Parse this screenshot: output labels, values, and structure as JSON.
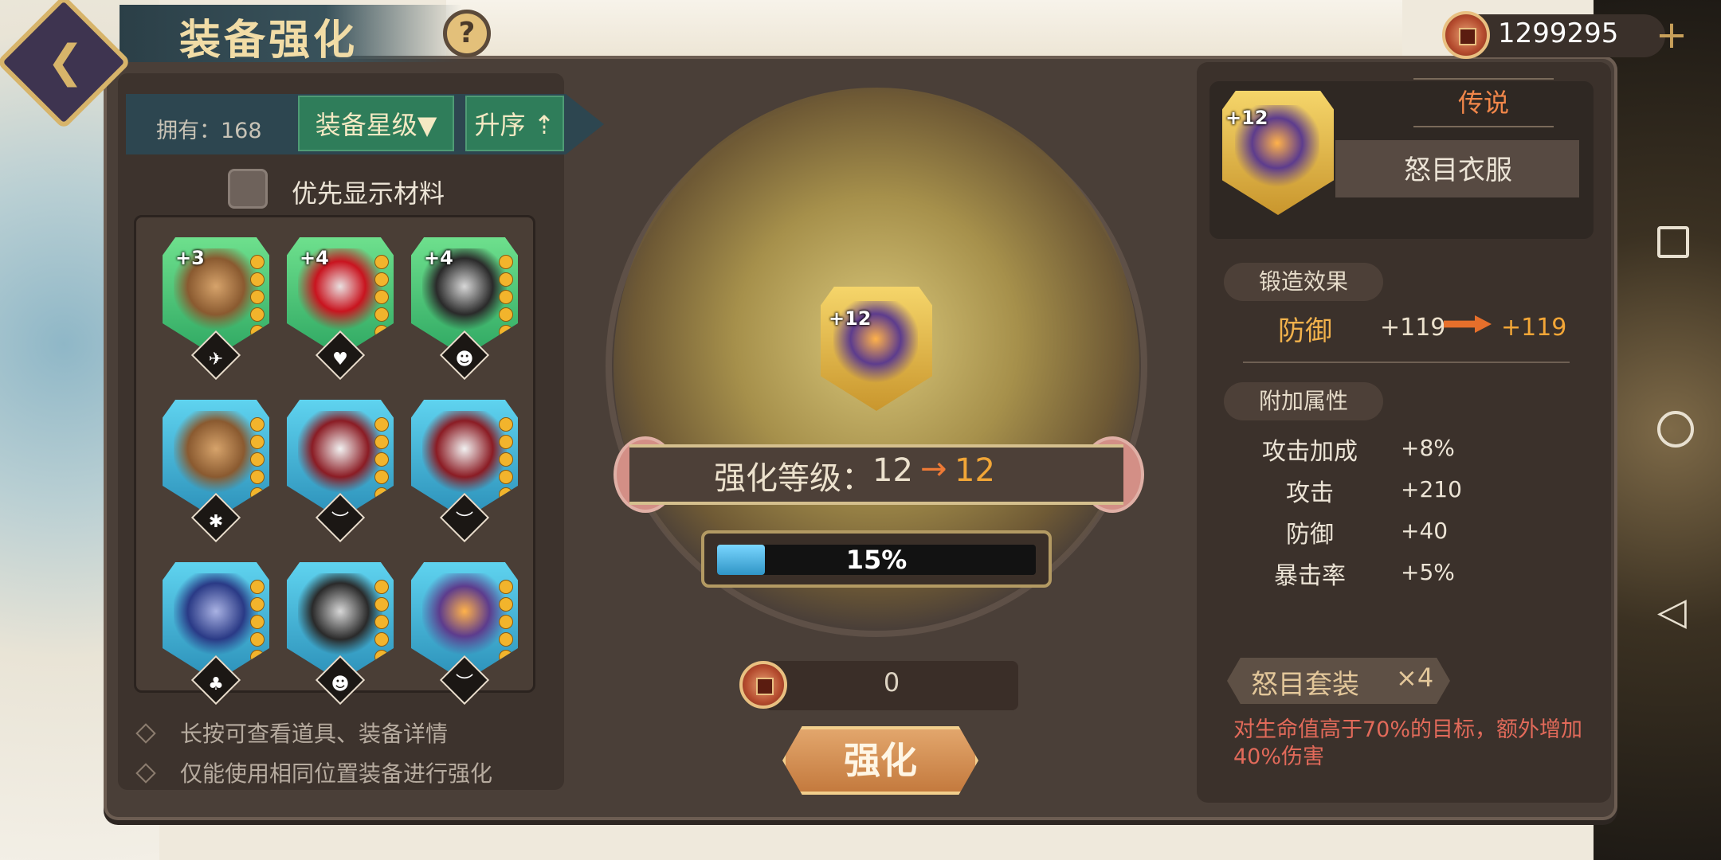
{
  "header": {
    "title": "装备强化",
    "help_label": "?",
    "currency": "1299295",
    "add_label": "+"
  },
  "filter": {
    "own_label": "拥有：168",
    "star_button": "装备星级▼",
    "sort_button": "升序 ⇡",
    "priority_label": "优先显示材料"
  },
  "slots": [
    {
      "level": "+3",
      "color": "green",
      "art": "coat"
    },
    {
      "level": "+4",
      "color": "green",
      "art": "red"
    },
    {
      "level": "+4",
      "color": "green",
      "art": "dark"
    },
    {
      "level": "",
      "color": "blue",
      "art": "coat"
    },
    {
      "level": "",
      "color": "blue",
      "art": "cape"
    },
    {
      "level": "",
      "color": "blue",
      "art": "cape"
    },
    {
      "level": "",
      "color": "blue",
      "art": "navy"
    },
    {
      "level": "",
      "color": "blue",
      "art": "dark"
    },
    {
      "level": "",
      "color": "blue",
      "art": "purple"
    }
  ],
  "hints": [
    "长按可查看道具、装备详情",
    "仅能使用相同位置装备进行强化"
  ],
  "center": {
    "item_level": "+12",
    "level_label": "强化等级：",
    "level_from": "12",
    "level_arrow": "→",
    "level_to": "12",
    "progress_text": "15%",
    "progress_fraction": 0.15,
    "cost": "0",
    "enhance_button": "强化"
  },
  "detail": {
    "item_level": "+12",
    "rarity": "传说",
    "name": "怒目衣服",
    "forge_title": "锻造效果",
    "main_stat": {
      "label": "防御",
      "from": "+119",
      "to": "+119"
    },
    "extra_title": "附加属性",
    "extra_stats": [
      {
        "label": "攻击加成",
        "value": "+8%"
      },
      {
        "label": "攻击",
        "value": "+210"
      },
      {
        "label": "防御",
        "value": "+40"
      },
      {
        "label": "暴击率",
        "value": "+5%"
      }
    ],
    "set_name": "怒目套装",
    "set_count": "×4",
    "set_desc": "对生命值高于70%的目标，额外增加40%伤害"
  },
  "colors": {
    "accent_orange": "#f2a637",
    "rarity_legendary": "#f2874a",
    "set_desc": "#e26a5a",
    "button_green": "#2f7d5a"
  }
}
